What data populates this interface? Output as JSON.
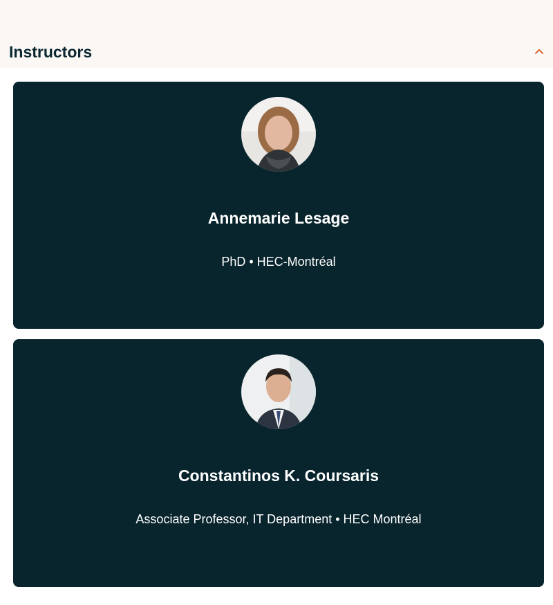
{
  "section": {
    "title": "Instructors",
    "toggle_icon": "chevron-up-icon",
    "accent_color": "#d9531e"
  },
  "instructors": [
    {
      "name": "Annemarie Lesage",
      "title": "PhD • HEC-Montréal"
    },
    {
      "name": "Constantinos K. Coursaris",
      "title": "Associate Professor, IT Department • HEC Montréal"
    }
  ],
  "colors": {
    "card_background": "#08242c",
    "header_background": "#faf7f4",
    "text_dark": "#0a2630",
    "text_light": "#ffffff"
  }
}
